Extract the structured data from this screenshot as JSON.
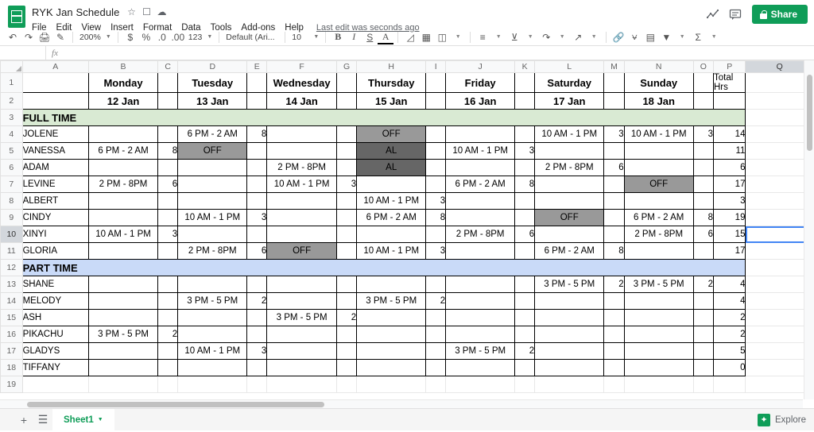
{
  "app": {
    "doc_title": "RYK Jan Schedule",
    "logo_icon": "sheets-logo-icon",
    "title_icons": [
      "star-icon",
      "move-to-folder-icon",
      "cloud-status-icon"
    ],
    "menus": [
      "File",
      "Edit",
      "View",
      "Insert",
      "Format",
      "Data",
      "Tools",
      "Add-ons",
      "Help"
    ],
    "last_edit": "Last edit was seconds ago",
    "right_icons": [
      "activity-chart-icon",
      "comment-icon"
    ],
    "share_label": "Share",
    "share_color": "#0f9d58"
  },
  "toolbar": {
    "zoom": "200%",
    "font": "Default (Ari...",
    "font_size": "10",
    "icons": [
      "undo-icon",
      "redo-icon",
      "print-icon",
      "paint-format-icon",
      "currency-icon",
      "percent-icon",
      "decrease-decimal-icon",
      "increase-decimal-icon",
      "more-formats-icon",
      "bold-icon",
      "italic-icon",
      "strikethrough-icon",
      "text-color-icon",
      "fill-color-icon",
      "borders-icon",
      "merge-cells-icon",
      "horizontal-align-icon",
      "vertical-align-icon",
      "text-wrap-icon",
      "text-rotation-icon",
      "insert-link-icon",
      "insert-comment-icon",
      "insert-chart-icon",
      "filter-icon",
      "functions-icon"
    ],
    "currency_symbol": "$",
    "percent_symbol": "%",
    "decimal_dec": ".0",
    "decimal_inc": ".00",
    "number_format": "123",
    "bold": "B",
    "italic": "I",
    "strike": "S",
    "text_color": "A"
  },
  "formula_bar": {
    "name_box": "",
    "fx_label": "fx",
    "content": ""
  },
  "grid": {
    "columns": [
      "A",
      "B",
      "C",
      "D",
      "E",
      "F",
      "G",
      "H",
      "I",
      "J",
      "K",
      "L",
      "M",
      "N",
      "O",
      "P",
      "Q"
    ],
    "selected_column": "Q",
    "selected_row": "10",
    "selected_cell": "Q10",
    "rows": [
      "1",
      "2",
      "3",
      "4",
      "5",
      "6",
      "7",
      "8",
      "9",
      "10",
      "11",
      "12",
      "13",
      "14",
      "15",
      "16",
      "17",
      "18",
      "19"
    ],
    "colors": {
      "full_time_bg": "#d9ead3",
      "part_time_bg": "#c9daf8",
      "off_bg": "#999999",
      "al_bg": "#666666",
      "selection": "#4285f4"
    },
    "header_days": [
      "",
      "Monday",
      "",
      "Tuesday",
      "",
      "Wednesday",
      "",
      "Thursday",
      "",
      "Friday",
      "",
      "Saturday",
      "",
      "Sunday",
      "",
      "Total Hrs"
    ],
    "header_dates": [
      "",
      "12 Jan",
      "",
      "13 Jan",
      "",
      "14 Jan",
      "",
      "15 Jan",
      "",
      "16 Jan",
      "",
      "17 Jan",
      "",
      "18 Jan",
      "",
      ""
    ],
    "section_full_time": "FULL TIME",
    "section_part_time": "PART TIME",
    "data_rows": [
      {
        "name": "JOLENE",
        "cells": [
          "",
          "",
          "6 PM - 2 AM",
          "8",
          "",
          "",
          "OFF",
          "",
          "",
          "",
          "10 AM - 1 PM",
          "3",
          "10 AM - 1 PM",
          "3",
          "14"
        ],
        "styles": [
          "",
          "",
          "",
          "",
          "",
          "",
          "off",
          "",
          "",
          "",
          "",
          "",
          "",
          "",
          ""
        ]
      },
      {
        "name": "VANESSA",
        "cells": [
          "6 PM - 2 AM",
          "8",
          "OFF",
          "",
          "",
          "",
          "AL",
          "",
          "10 AM - 1 PM",
          "3",
          "",
          "",
          "",
          "",
          "11"
        ],
        "styles": [
          "",
          "",
          "off",
          "",
          "",
          "",
          "al",
          "",
          "",
          "",
          "",
          "",
          "",
          "",
          ""
        ]
      },
      {
        "name": "ADAM",
        "cells": [
          "",
          "",
          "",
          "",
          "2 PM - 8PM",
          "",
          "AL",
          "",
          "",
          "",
          "2 PM - 8PM",
          "6",
          "",
          "",
          "6"
        ],
        "styles": [
          "",
          "",
          "",
          "",
          "",
          "",
          "al",
          "",
          "",
          "",
          "",
          "",
          "",
          "",
          ""
        ]
      },
      {
        "name": "LEVINE",
        "cells": [
          "2 PM - 8PM",
          "6",
          "",
          "",
          "10 AM - 1 PM",
          "3",
          "",
          "",
          "6 PM - 2 AM",
          "8",
          "",
          "",
          "OFF",
          "",
          "17"
        ],
        "styles": [
          "",
          "",
          "",
          "",
          "",
          "",
          "",
          "",
          "",
          "",
          "",
          "",
          "off",
          "",
          ""
        ]
      },
      {
        "name": "ALBERT",
        "cells": [
          "",
          "",
          "",
          "",
          "",
          "",
          "10 AM - 1 PM",
          "3",
          "",
          "",
          "",
          "",
          "",
          "",
          "3"
        ],
        "styles": [
          "",
          "",
          "",
          "",
          "",
          "",
          "",
          "",
          "",
          "",
          "",
          "",
          "",
          "",
          ""
        ]
      },
      {
        "name": "CINDY",
        "cells": [
          "",
          "",
          "10 AM - 1 PM",
          "3",
          "",
          "",
          "6 PM - 2 AM",
          "8",
          "",
          "",
          "OFF",
          "",
          "6 PM - 2 AM",
          "8",
          "19"
        ],
        "styles": [
          "",
          "",
          "",
          "",
          "",
          "",
          "",
          "",
          "",
          "",
          "off",
          "",
          "",
          "",
          ""
        ]
      },
      {
        "name": "XINYI",
        "cells": [
          "10 AM - 1 PM",
          "3",
          "",
          "",
          "",
          "",
          "",
          "",
          "2 PM - 8PM",
          "6",
          "",
          "",
          "2 PM - 8PM",
          "6",
          "15"
        ],
        "styles": [
          "",
          "",
          "",
          "",
          "",
          "",
          "",
          "",
          "",
          "",
          "",
          "",
          "",
          "",
          ""
        ]
      },
      {
        "name": "GLORIA",
        "cells": [
          "",
          "",
          "2 PM - 8PM",
          "6",
          "OFF",
          "",
          "10 AM - 1 PM",
          "3",
          "",
          "",
          "6 PM - 2 AM",
          "8",
          "",
          "",
          "17"
        ],
        "styles": [
          "",
          "",
          "",
          "",
          "off",
          "",
          "",
          "",
          "",
          "",
          "",
          "",
          "",
          "",
          ""
        ]
      }
    ],
    "part_time_rows": [
      {
        "name": "SHANE",
        "cells": [
          "",
          "",
          "",
          "",
          "",
          "",
          "",
          "",
          "",
          "",
          "3 PM - 5 PM",
          "2",
          "3 PM - 5 PM",
          "2",
          "4"
        ],
        "styles": [
          "",
          "",
          "",
          "",
          "",
          "",
          "",
          "",
          "",
          "",
          "",
          "",
          "",
          "",
          ""
        ]
      },
      {
        "name": "MELODY",
        "cells": [
          "",
          "",
          "3 PM - 5 PM",
          "2",
          "",
          "",
          "3 PM - 5 PM",
          "2",
          "",
          "",
          "",
          "",
          "",
          "",
          "4"
        ],
        "styles": [
          "",
          "",
          "",
          "",
          "",
          "",
          "",
          "",
          "",
          "",
          "",
          "",
          "",
          "",
          ""
        ]
      },
      {
        "name": "ASH",
        "cells": [
          "",
          "",
          "",
          "",
          "3 PM - 5 PM",
          "2",
          "",
          "",
          "",
          "",
          "",
          "",
          "",
          "",
          "2"
        ],
        "styles": [
          "",
          "",
          "",
          "",
          "",
          "",
          "",
          "",
          "",
          "",
          "",
          "",
          "",
          "",
          ""
        ]
      },
      {
        "name": "PIKACHU",
        "cells": [
          "3 PM - 5 PM",
          "2",
          "",
          "",
          "",
          "",
          "",
          "",
          "",
          "",
          "",
          "",
          "",
          "",
          "2"
        ],
        "styles": [
          "",
          "",
          "",
          "",
          "",
          "",
          "",
          "",
          "",
          "",
          "",
          "",
          "",
          "",
          ""
        ]
      },
      {
        "name": "GLADYS",
        "cells": [
          "",
          "",
          "10 AM - 1 PM",
          "3",
          "",
          "",
          "",
          "",
          "3 PM - 5 PM",
          "2",
          "",
          "",
          "",
          "",
          "5"
        ],
        "styles": [
          "",
          "",
          "",
          "",
          "",
          "",
          "",
          "",
          "",
          "",
          "",
          "",
          "",
          "",
          ""
        ]
      },
      {
        "name": "TIFFANY",
        "cells": [
          "",
          "",
          "",
          "",
          "",
          "",
          "",
          "",
          "",
          "",
          "",
          "",
          "",
          "",
          "0"
        ],
        "styles": [
          "",
          "",
          "",
          "",
          "",
          "",
          "",
          "",
          "",
          "",
          "",
          "",
          "",
          "",
          ""
        ]
      }
    ]
  },
  "bottom": {
    "add_sheet_icon": "add-sheet-icon",
    "all_sheets_icon": "all-sheets-icon",
    "sheet_name": "Sheet1",
    "explore_label": "Explore",
    "explore_icon": "explore-icon"
  }
}
